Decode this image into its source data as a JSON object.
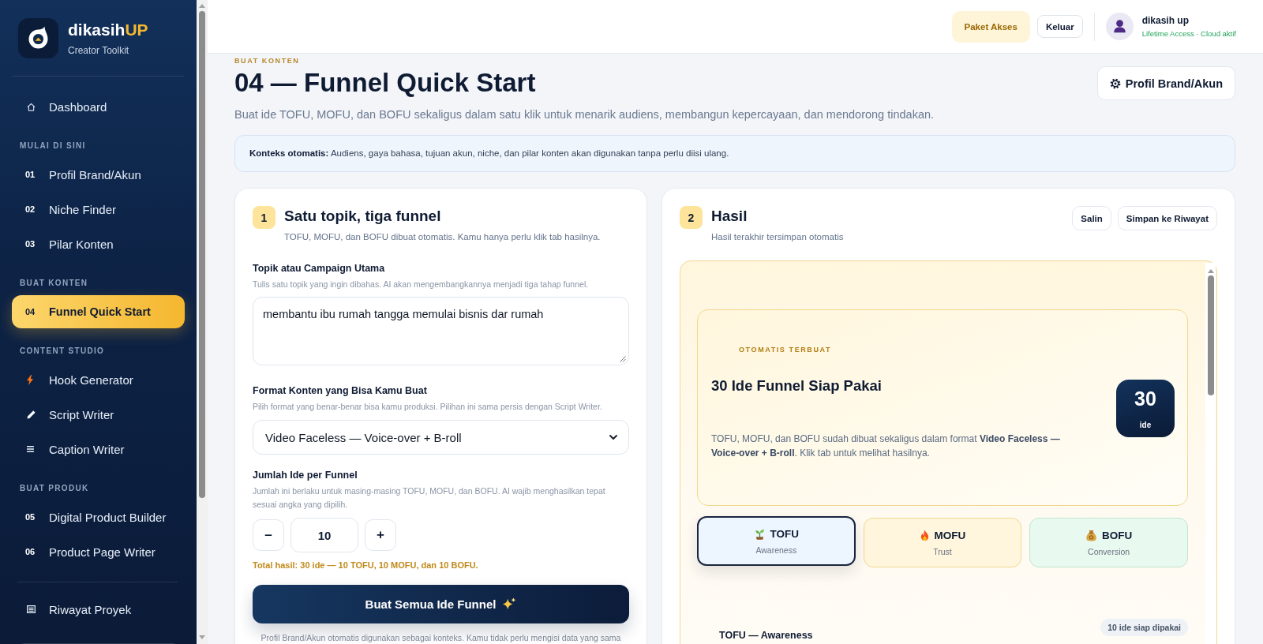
{
  "sidebar": {
    "brand": {
      "name": "dikasih",
      "accent": "UP",
      "tagline": "Creator Toolkit"
    },
    "nav": [
      {
        "label": "Dashboard",
        "selected": false
      }
    ],
    "sections": [
      {
        "title": "MULAI DI SINI",
        "items": [
          {
            "number": "01",
            "label": "Profil Brand/Akun",
            "selected": false
          },
          {
            "number": "02",
            "label": "Niche Finder",
            "selected": false
          },
          {
            "number": "03",
            "label": "Pilar Konten",
            "selected": false
          }
        ]
      },
      {
        "title": "BUAT KONTEN",
        "items": [
          {
            "number": "04",
            "label": "Funnel Quick Start",
            "selected": true
          }
        ]
      },
      {
        "title": "CONTENT STUDIO",
        "items": [
          {
            "label": "Hook Generator",
            "selected": false
          },
          {
            "label": "Script Writer",
            "selected": false
          },
          {
            "label": "Caption Writer",
            "selected": false
          }
        ]
      },
      {
        "title": "BUAT PRODUK",
        "items": [
          {
            "number": "05",
            "label": "Digital Product Builder",
            "selected": false
          },
          {
            "number": "06",
            "label": "Product Page Writer",
            "selected": false
          }
        ]
      }
    ],
    "footer_nav": [
      {
        "label": "Riwayat Proyek",
        "selected": false
      }
    ]
  },
  "top_bar": {
    "buttons": [
      {
        "kind": "accent",
        "label": "Paket Akses"
      },
      {
        "kind": "outline",
        "label": "Keluar"
      }
    ],
    "user": {
      "name": "dikasih up",
      "status": "Lifetime Access · Cloud aktif"
    }
  },
  "header": {
    "eyebrow": "BUAT KONTEN",
    "title": "04 — Funnel Quick Start",
    "subtitle": "Buat ide TOFU, MOFU, dan BOFU sekaligus dalam satu klik untuk menarik audiens, membangun kepercayaan, dan mendorong tindakan.",
    "action": "Profil Brand/Akun"
  },
  "context_note": "**Konteks otomatis:** Audiens, gaya bahasa, tujuan akun, niche, dan pilar konten akan digunakan tanpa perlu diisi ulang.",
  "form": {
    "step": "1",
    "title": "Satu topik, tiga funnel",
    "subtitle": "TOFU, MOFU, dan BOFU dibuat otomatis. Kamu hanya perlu klik tab hasilnya.",
    "fields": [
      {
        "kind": "textarea",
        "label": "Topik atau Campaign Utama",
        "hint": "Tulis satu topik yang ingin dibahas. AI akan mengembangkannya menjadi tiga tahap funnel.",
        "value": "membantu ibu rumah tangga memulai bisnis dar rumah"
      },
      {
        "kind": "select",
        "label": "Format Konten yang Bisa Kamu Buat",
        "hint": "Pilih format yang benar-benar bisa kamu produksi. Pilihan ini sama persis dengan Script Writer.",
        "value": "Video Faceless — Voice-over + B-roll"
      },
      {
        "kind": "stepper",
        "label": "Jumlah Ide per Funnel",
        "hint": "Jumlah ini berlaku untuk masing-masing TOFU, MOFU, dan BOFU. AI wajib menghasilkan tepat sesuai angka yang dipilih.",
        "value": "10",
        "decrement": "–",
        "increment": "+"
      }
    ],
    "total": "Total hasil: 30 ide — 10 TOFU, 10 MOFU, dan 10 BOFU.",
    "submit": "Buat Semua Ide Funnel",
    "note": "Profil Brand/Akun otomatis digunakan sebagai konteks. Kamu tidak perlu mengisi data yang sama"
  },
  "result": {
    "step": "2",
    "title": "Hasil",
    "subtitle": "Hasil terakhir tersimpan otomatis",
    "actions": [
      "Salin",
      "Simpan ke Riwayat"
    ],
    "summary": {
      "eyebrow": "OTOMATIS TERBUAT",
      "title": "30 Ide Funnel Siap Pakai",
      "description": "TOFU, MOFU, dan BOFU sudah dibuat sekaligus dalam format **Video Faceless — Voice-over + B-roll**. Klik tab untuk melihat hasilnya.",
      "count": "30",
      "count_unit": "ide"
    },
    "tabs": [
      {
        "label": "TOFU",
        "sublabel": "Awareness",
        "selected": true,
        "color": "#edf5ff"
      },
      {
        "label": "MOFU",
        "sublabel": "Trust",
        "selected": false,
        "color": "#fff6dd"
      },
      {
        "label": "BOFU",
        "sublabel": "Conversion",
        "selected": false,
        "color": "#e8f9ef"
      }
    ],
    "section": {
      "title": "TOFU — Awareness",
      "badge": "10 ide siap dipakai"
    }
  }
}
